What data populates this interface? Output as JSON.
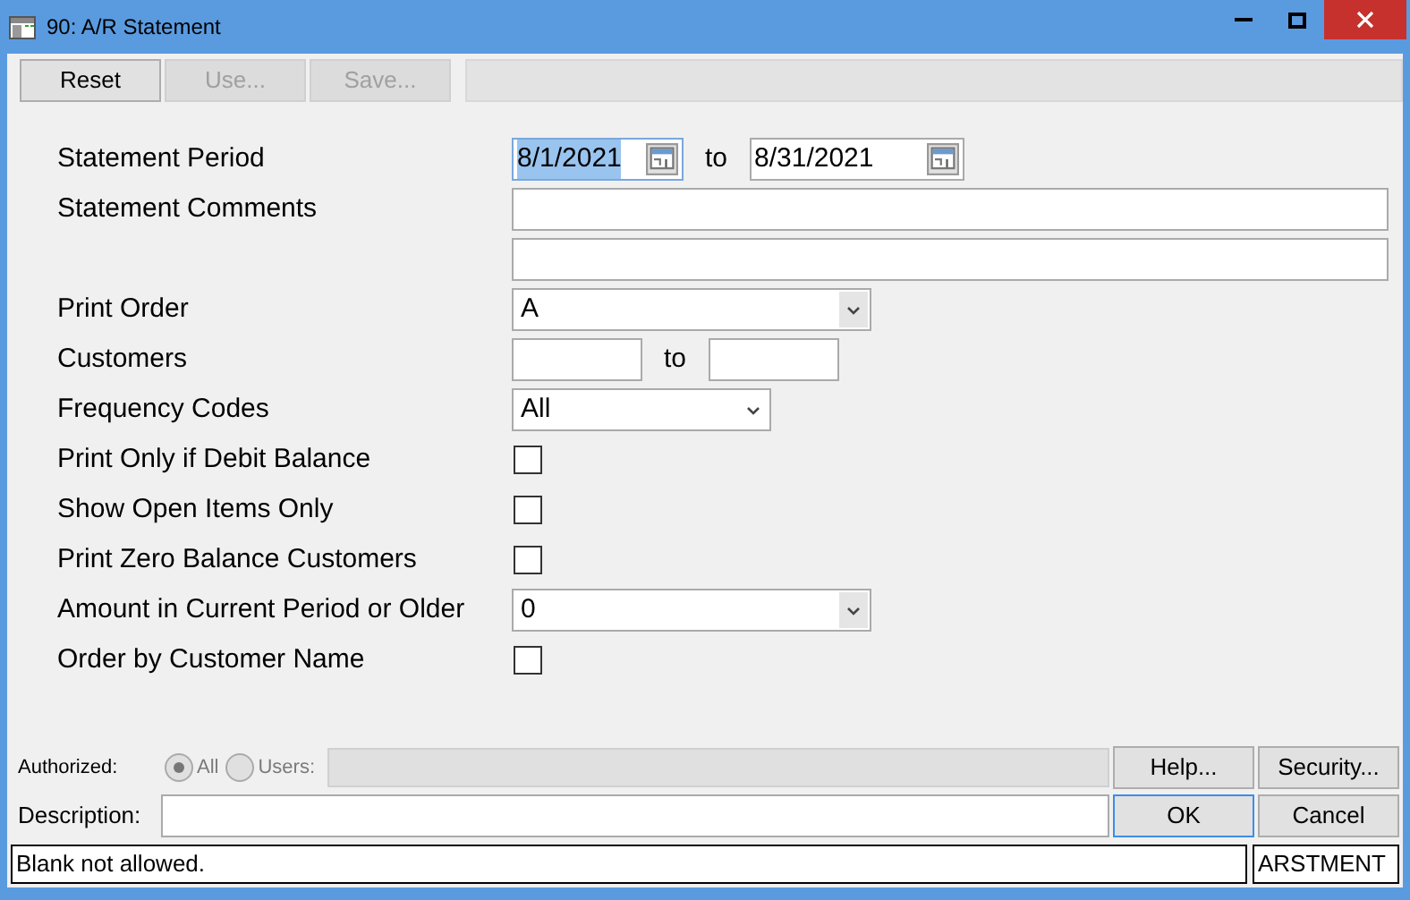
{
  "window": {
    "title": "90: A/R Statement"
  },
  "toolbar": [
    {
      "label": "Reset",
      "disabled": false
    },
    {
      "label": "Use...",
      "disabled": true
    },
    {
      "label": "Save...",
      "disabled": true
    }
  ],
  "form": [
    {
      "kind": "date_range",
      "label": "Statement Period",
      "from": "8/1/2021",
      "from_selected": true,
      "separator": "to",
      "to": "8/31/2021"
    },
    {
      "kind": "text",
      "label": "Statement Comments"
    },
    {
      "kind": "text"
    },
    {
      "kind": "combo",
      "label": "Print Order",
      "value": "A"
    },
    {
      "kind": "range",
      "label": "Customers",
      "separator": "to"
    },
    {
      "kind": "select",
      "label": "Frequency Codes",
      "value": "All"
    },
    {
      "kind": "checkbox",
      "label": "Print Only if Debit Balance",
      "checked": false
    },
    {
      "kind": "checkbox",
      "label": "Show Open Items Only",
      "checked": false
    },
    {
      "kind": "checkbox",
      "label": "Print Zero Balance Customers",
      "checked": false
    },
    {
      "kind": "combo",
      "label": "Amount in Current Period or Older",
      "value": "0"
    },
    {
      "kind": "checkbox",
      "label": "Order by Customer Name",
      "checked": false
    }
  ],
  "authorized": {
    "label": "Authorized:",
    "options": [
      {
        "label": "All",
        "selected": true
      },
      {
        "label": "Users:",
        "selected": false
      }
    ]
  },
  "description": {
    "label": "Description:"
  },
  "buttons": [
    {
      "label": "Help..."
    },
    {
      "label": "Security..."
    },
    {
      "label": "OK",
      "default": true
    },
    {
      "label": "Cancel",
      "default": false
    }
  ],
  "status_bar": {
    "message": "Blank not allowed.",
    "code": "ARSTMENT"
  }
}
